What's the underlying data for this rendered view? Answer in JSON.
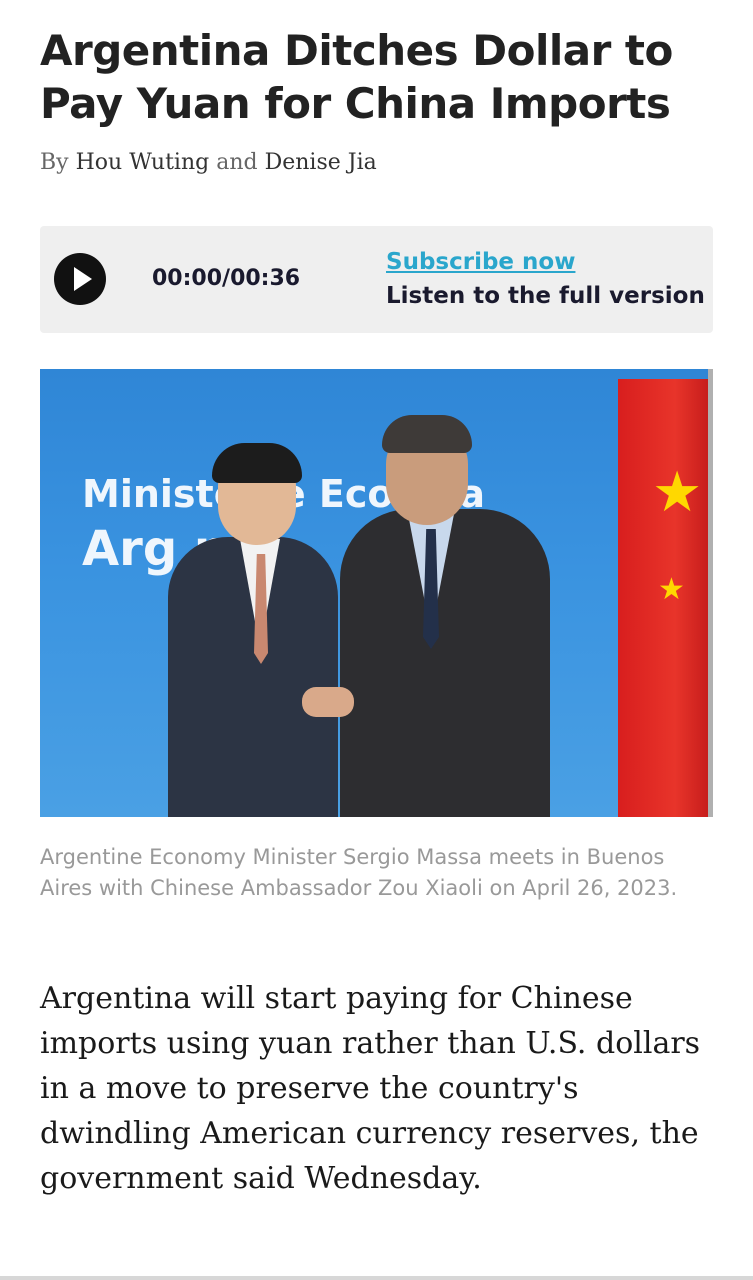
{
  "article": {
    "headline": "Argentina Ditches Dollar to Pay Yuan for China Imports",
    "byline": {
      "prefix": "By",
      "author1": "Hou Wuting",
      "conjunction": "and",
      "author2": "Denise Jia"
    },
    "audio": {
      "time": "00:00/00:36",
      "subscribe_label": "Subscribe now",
      "listen_label": "Listen to the full version",
      "play_icon": "play-icon"
    },
    "photo": {
      "backdrop_line1": "Ministe      de Eco      mía",
      "backdrop_line2": "Arg          na"
    },
    "caption": "Argentine Economy Minister Sergio Massa meets in Buenos Aires with Chinese Ambassador Zou Xiaoli on April 26, 2023.",
    "body": "Argentina will start paying for Chinese imports using yuan rather than U.S. dollars in a move to preserve the country's dwindling American currency reserves, the government said Wednesday."
  },
  "colors": {
    "link": "#2aa6cc",
    "audio_bg": "#efefef",
    "caption": "#999999"
  }
}
